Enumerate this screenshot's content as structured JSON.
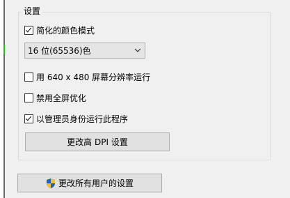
{
  "group": {
    "title": "设置"
  },
  "options": {
    "reduced_color": {
      "label": "简化的颜色模式",
      "checked": true
    },
    "color_select": {
      "value": "16 位(65536)色"
    },
    "run_640": {
      "label": "用 640 x 480 屏幕分辨率运行",
      "checked": false
    },
    "disable_fullscreen": {
      "label": "禁用全屏优化",
      "checked": false
    },
    "run_as_admin": {
      "label": "以管理员身份运行此程序",
      "checked": true
    }
  },
  "buttons": {
    "change_dpi": "更改高 DPI 设置",
    "change_all_users": "更改所有用户的设置"
  },
  "icons": {
    "dropdown": "chevron-down-icon",
    "shield": "uac-shield-icon"
  },
  "colors": {
    "shield_blue": "#1e5fbf",
    "shield_yellow": "#f2c230"
  }
}
